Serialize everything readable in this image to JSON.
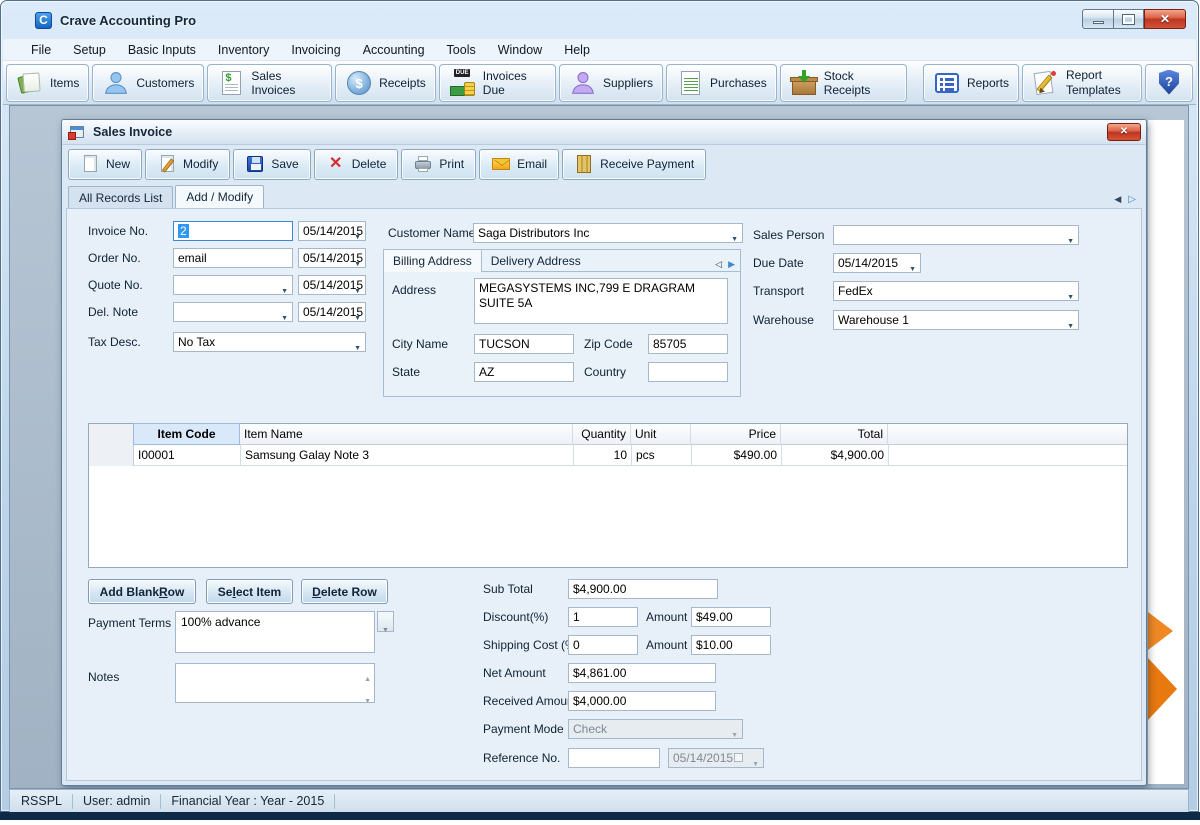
{
  "window": {
    "title": "Crave Accounting Pro",
    "logo_letter": "C"
  },
  "menu": {
    "items": [
      "File",
      "Setup",
      "Basic Inputs",
      "Inventory",
      "Invoicing",
      "Accounting",
      "Tools",
      "Window",
      "Help"
    ]
  },
  "app_toolbar": {
    "due_badge": "DUE",
    "items": [
      {
        "label": "Items"
      },
      {
        "label": "Customers"
      },
      {
        "label": "Sales Invoices"
      },
      {
        "label": "Receipts"
      },
      {
        "label": "Invoices Due"
      },
      {
        "label": "Suppliers"
      },
      {
        "label": "Purchases"
      },
      {
        "label": "Stock Receipts"
      },
      {
        "label": "Reports"
      },
      {
        "label": "Report Templates"
      }
    ]
  },
  "invoice_window": {
    "title": "Sales Invoice",
    "toolbar": {
      "new": "New",
      "modify": "Modify",
      "save": "Save",
      "delete": "Delete",
      "print": "Print",
      "email": "Email",
      "receive_payment": "Receive Payment"
    },
    "tabs": {
      "all_records": "All Records List",
      "add_modify": "Add / Modify"
    },
    "form": {
      "invoice_no": {
        "label": "Invoice No.",
        "value": "2",
        "date": "05/14/2015"
      },
      "order_no": {
        "label": "Order No.",
        "value": "email",
        "date": "05/14/2015"
      },
      "quote_no": {
        "label": "Quote No.",
        "value": "",
        "date": "05/14/2015"
      },
      "del_note": {
        "label": "Del. Note",
        "value": "",
        "date": "05/14/2015"
      },
      "tax_desc": {
        "label": "Tax Desc.",
        "value": "No Tax"
      },
      "customer_name": {
        "label": "Customer Name",
        "value": "Saga Distributors Inc"
      },
      "address_tabs": {
        "billing": "Billing Address",
        "delivery": "Delivery Address"
      },
      "address": {
        "label": "Address",
        "value": "MEGASYSTEMS INC,799 E DRAGRAM SUITE 5A"
      },
      "city": {
        "label": "City Name",
        "value": "TUCSON"
      },
      "zip": {
        "label": "Zip Code",
        "value": "85705"
      },
      "state": {
        "label": "State",
        "value": "AZ"
      },
      "country": {
        "label": "Country",
        "value": ""
      },
      "sales_person": {
        "label": "Sales Person",
        "value": ""
      },
      "due_date": {
        "label": "Due Date",
        "value": "05/14/2015"
      },
      "transport": {
        "label": "Transport",
        "value": "FedEx"
      },
      "warehouse": {
        "label": "Warehouse",
        "value": "Warehouse 1"
      }
    },
    "grid": {
      "columns": [
        "Item Code",
        "Item Name",
        "Quantity",
        "Unit",
        "Price",
        "Total"
      ],
      "rows": [
        [
          "I00001",
          "Samsung Galay Note 3",
          "10",
          "pcs",
          "$490.00",
          "$4,900.00"
        ]
      ]
    },
    "row_buttons": [
      {
        "pre": "Add Blank ",
        "key": "R",
        "post": "ow"
      },
      {
        "pre": "Se",
        "key": "l",
        "post": "ect Item"
      },
      {
        "pre": "",
        "key": "D",
        "post": "elete Row"
      }
    ],
    "payment_terms": {
      "label": "Payment Terms",
      "value": "100% advance"
    },
    "notes": {
      "label": "Notes",
      "value": ""
    },
    "totals": {
      "sub_total": {
        "label": "Sub Total",
        "value": "$4,900.00"
      },
      "discount": {
        "label": "Discount(%)",
        "value": "1",
        "amount_label": "Amount",
        "amount": "$49.00"
      },
      "shipping": {
        "label": "Shipping Cost (%)",
        "value": "0",
        "amount_label": "Amount",
        "amount": "$10.00"
      },
      "net_amount": {
        "label": "Net Amount",
        "value": "$4,861.00"
      },
      "received_amount": {
        "label": "Received Amount",
        "value": "$4,000.00"
      },
      "payment_mode": {
        "label": "Payment Mode",
        "value": "Check"
      },
      "reference_no": {
        "label": "Reference No.",
        "value": "",
        "date": "05/14/2015"
      }
    }
  },
  "statusbar": {
    "company": "RSSPL",
    "user": "User: admin",
    "financial_year": "Financial Year : Year - 2015"
  },
  "colors": {
    "accent_orange": "#ef8823",
    "close_red": "#bb3620",
    "selection_blue": "#2f96f2"
  }
}
